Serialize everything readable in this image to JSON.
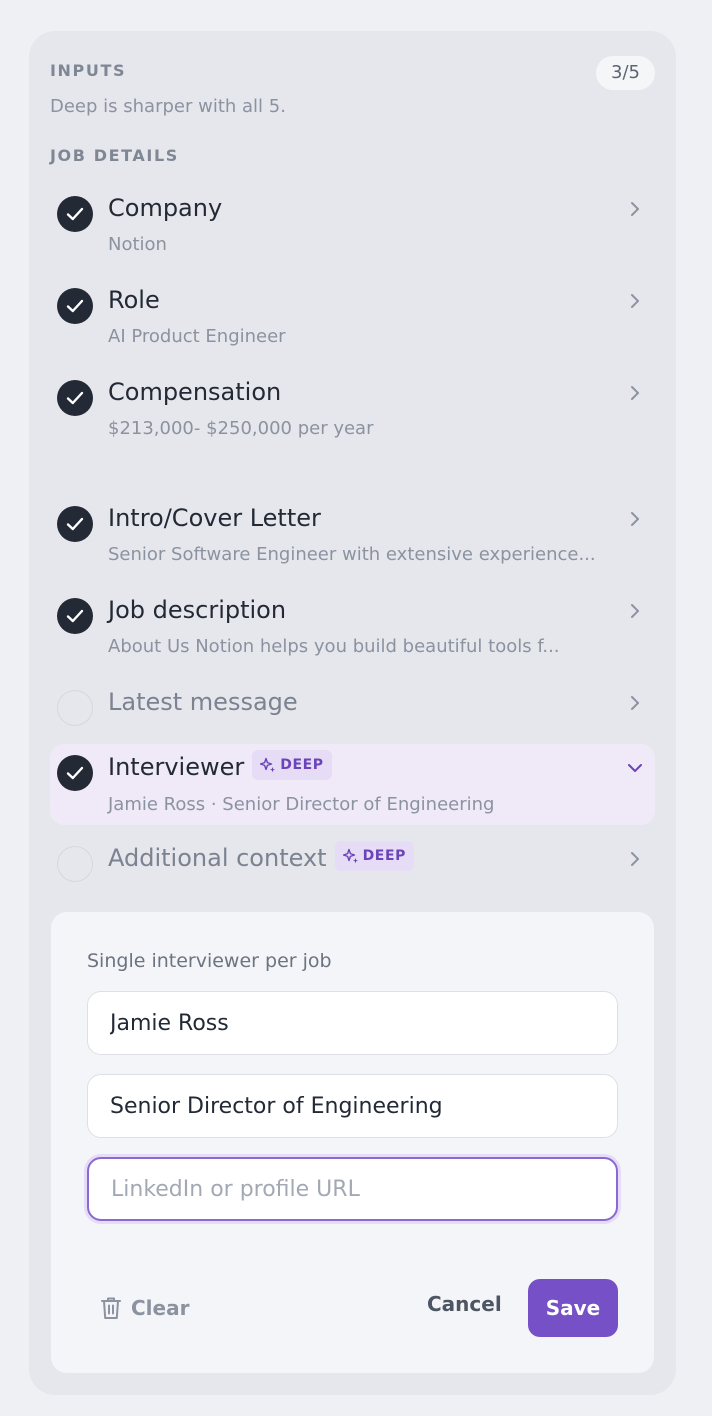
{
  "header": {
    "section_label": "INPUTS",
    "counter": "3/5",
    "hint": "Deep is sharper with all 5."
  },
  "job_details": {
    "section_label": "JOB DETAILS",
    "items": [
      {
        "title": "Company",
        "value": "Notion",
        "completed": true
      },
      {
        "title": "Role",
        "value": "AI Product Engineer",
        "completed": true
      },
      {
        "title": "Compensation",
        "value": "$213,000- $250,000 per year",
        "completed": true
      }
    ]
  },
  "materials": {
    "items": [
      {
        "title": "Intro/Cover Letter",
        "value": "Senior Software Engineer with extensive experience...",
        "completed": true
      },
      {
        "title": "Job description",
        "value": "About Us Notion helps you build beautiful tools f...",
        "completed": true
      },
      {
        "title": "Latest message",
        "completed": false
      },
      {
        "title": "Interviewer",
        "badge": "DEEP",
        "value": "Jamie Ross · Senior Director of Engineering",
        "completed": true,
        "expanded": true
      },
      {
        "title": "Additional context",
        "badge": "DEEP",
        "completed": false
      }
    ]
  },
  "interviewer_form": {
    "label": "Single interviewer per job",
    "name_value": "Jamie Ross",
    "title_value": "Senior Director of Engineering",
    "url_placeholder": "LinkedIn or profile URL",
    "clear_label": "Clear",
    "cancel_label": "Cancel",
    "save_label": "Save"
  },
  "colors": {
    "accent": "#7550c6",
    "check": "#232a36",
    "highlight": "#efe9f8",
    "badge_bg": "#e7dcf6",
    "badge_text": "#6a44b8"
  }
}
